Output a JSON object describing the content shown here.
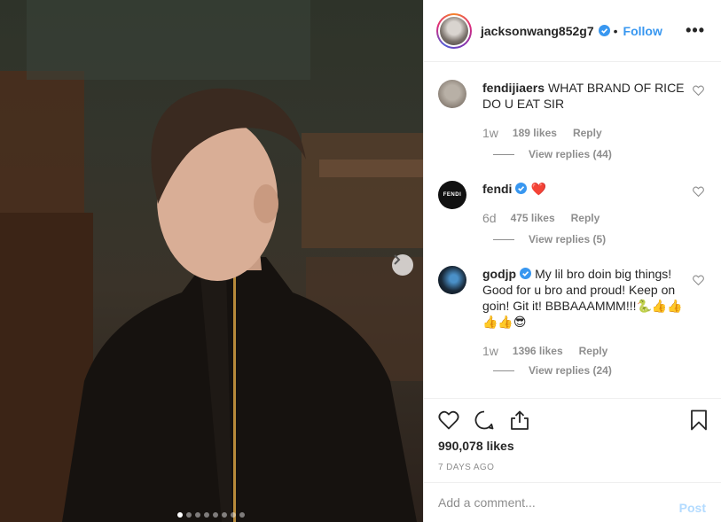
{
  "post": {
    "author": "jacksonwang852g7",
    "follow_label": "Follow",
    "separator": "•",
    "more_label": "•••",
    "carousel_count": 8,
    "carousel_active": 1
  },
  "comments": [
    {
      "user": "fendijiaers",
      "text": "WHAT BRAND OF RICE DO U EAT SIR",
      "time": "1w",
      "likes": "189 likes",
      "reply_label": "Reply",
      "view_replies": "View replies (44)",
      "verified": false
    },
    {
      "user": "fendi",
      "text": "❤️",
      "time": "6d",
      "likes": "475 likes",
      "reply_label": "Reply",
      "view_replies": "View replies (5)",
      "verified": true,
      "avatar_text": "FENDI"
    },
    {
      "user": "godjp",
      "text": "My lil bro doin big things! Good for u bro and proud! Keep on goin! Git it! BBBAAAMMM!!!🐍👍👍👍👍😎",
      "time": "1w",
      "likes": "1396 likes",
      "reply_label": "Reply",
      "view_replies": "View replies (24)",
      "verified": true
    }
  ],
  "footer": {
    "likes": "990,078 likes",
    "time_ago": "7 DAYS AGO",
    "comment_placeholder": "Add a comment...",
    "post_label": "Post"
  },
  "icons": [
    "verified-icon",
    "heart-icon",
    "comment-icon",
    "share-icon",
    "bookmark-icon",
    "chevron-right-icon",
    "more-icon"
  ],
  "colors": {
    "link": "#3897f0",
    "muted": "#8e8e8e",
    "text": "#262626",
    "post_disabled": "#b3dbff",
    "border": "#efefef"
  }
}
